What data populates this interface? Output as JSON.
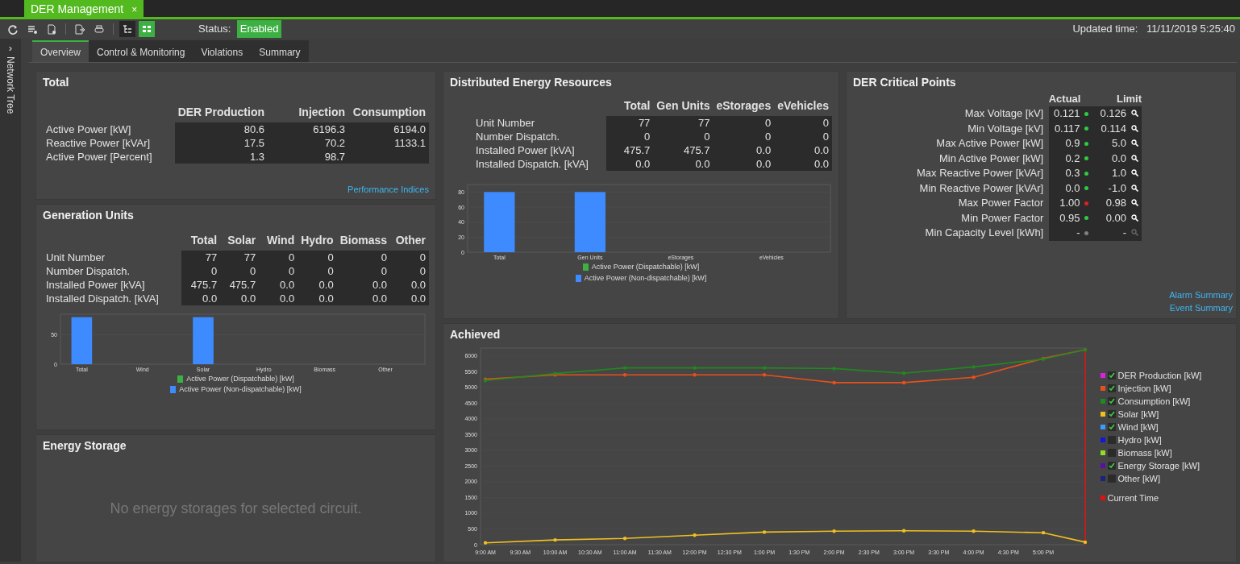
{
  "window": {
    "tab_title": "DER Management",
    "close": "×"
  },
  "toolbar": {
    "buttons": [
      {
        "kind": "refresh",
        "selected": false
      },
      {
        "kind": "list",
        "selected": false
      },
      {
        "kind": "document",
        "selected": false
      },
      {
        "kind": "export",
        "selected": false
      },
      {
        "kind": "print",
        "selected": false
      },
      {
        "kind": "tree",
        "selected": false
      },
      {
        "kind": "grid",
        "selected": true
      }
    ],
    "status_label": "Status:",
    "status_value": "Enabled",
    "updated_label": "Updated time:",
    "updated_value": "11/11/2019 5:25:40"
  },
  "side_panel": {
    "toggle": "›",
    "label": "Network Tree"
  },
  "tabs": [
    {
      "label": "Overview",
      "selected": true
    },
    {
      "label": "Control & Monitoring",
      "selected": false
    },
    {
      "label": "Violations",
      "selected": false
    },
    {
      "label": "Summary",
      "selected": false
    }
  ],
  "total": {
    "title": "Total",
    "columns": [
      "DER Production",
      "Injection",
      "Consumption"
    ],
    "rows": [
      {
        "label": "Active Power [kW]",
        "values": [
          "80.6",
          "6196.3",
          "6194.0"
        ]
      },
      {
        "label": "Reactive Power [kVAr]",
        "values": [
          "17.5",
          "70.2",
          "1133.1"
        ]
      },
      {
        "label": "Active Power [Percent]",
        "values": [
          "1.3",
          "98.7"
        ]
      }
    ],
    "link": "Performance Indices"
  },
  "generation_units": {
    "title": "Generation Units",
    "columns": [
      "Total",
      "Solar",
      "Wind",
      "Hydro",
      "Biomass",
      "Other"
    ],
    "rows": [
      {
        "label": "Unit Number",
        "values": [
          "77",
          "77",
          "0",
          "0",
          "0",
          "0"
        ]
      },
      {
        "label": "Number Dispatch.",
        "values": [
          "0",
          "0",
          "0",
          "0",
          "0",
          "0"
        ]
      },
      {
        "label": "Installed Power [kVA]",
        "values": [
          "475.7",
          "475.7",
          "0.0",
          "0.0",
          "0.0",
          "0.0"
        ]
      },
      {
        "label": "Installed Dispatch. [kVA]",
        "values": [
          "0.0",
          "0.0",
          "0.0",
          "0.0",
          "0.0",
          "0.0"
        ]
      }
    ],
    "chart_data": {
      "type": "bar",
      "categories": [
        "Total",
        "Wind",
        "Solar",
        "Hydro",
        "Biomass",
        "Other"
      ],
      "ylim": [
        0,
        85
      ],
      "yticks": [
        0,
        50
      ],
      "stacked": true,
      "grid": true,
      "series": [
        {
          "name": "Active Power (Dispatchable) [kW]",
          "color": "#3cb043",
          "values": [
            0,
            0,
            0,
            0,
            0,
            0
          ]
        },
        {
          "name": "Active Power (Non-dispatchable) [kW]",
          "color": "#3d8bff",
          "values": [
            80,
            0,
            80,
            0,
            0,
            0
          ]
        }
      ]
    }
  },
  "energy_storage": {
    "title": "Energy Storage",
    "message": "No energy storages for selected circuit."
  },
  "distributed_energy_resources": {
    "title": "Distributed Energy Resources",
    "columns": [
      "Total",
      "Gen Units",
      "eStorages",
      "eVehicles"
    ],
    "rows": [
      {
        "label": "Unit Number",
        "values": [
          "77",
          "77",
          "0",
          "0"
        ]
      },
      {
        "label": "Number Dispatch.",
        "values": [
          "0",
          "0",
          "0",
          "0"
        ]
      },
      {
        "label": "Installed Power [kVA]",
        "values": [
          "475.7",
          "475.7",
          "0.0",
          "0.0"
        ]
      },
      {
        "label": "Installed Dispatch. [kVA]",
        "values": [
          "0.0",
          "0.0",
          "0.0",
          "0.0"
        ]
      }
    ],
    "chart_data": {
      "type": "bar",
      "categories": [
        "Total",
        "Gen Units",
        "eStorages",
        "eVehicles"
      ],
      "ylim": [
        0,
        90
      ],
      "yticks": [
        0,
        20,
        40,
        60,
        80
      ],
      "stacked": true,
      "grid": true,
      "series": [
        {
          "name": "Active Power (Dispatchable) [kW]",
          "color": "#3cb043",
          "values": [
            0,
            0,
            0,
            0
          ]
        },
        {
          "name": "Active Power (Non-dispatchable) [kW]",
          "color": "#3d8bff",
          "values": [
            80,
            80,
            0,
            0
          ]
        }
      ]
    }
  },
  "critical_points": {
    "title": "DER Critical Points",
    "columns": [
      "Actual",
      "Limit"
    ],
    "rows": [
      {
        "label": "Max Voltage [kV]",
        "actual": "0.121",
        "limit": "0.126",
        "color": "#2ecc40",
        "disabled": false
      },
      {
        "label": "Min Voltage [kV]",
        "actual": "0.117",
        "limit": "0.114",
        "color": "#2ecc40",
        "disabled": false
      },
      {
        "label": "Max Active Power [kW]",
        "actual": "0.9",
        "limit": "5.0",
        "color": "#2ecc40",
        "disabled": false
      },
      {
        "label": "Min Active Power [kW]",
        "actual": "0.2",
        "limit": "0.0",
        "color": "#2ecc40",
        "disabled": false
      },
      {
        "label": "Max Reactive Power [kVAr]",
        "actual": "0.3",
        "limit": "1.0",
        "color": "#2ecc40",
        "disabled": false
      },
      {
        "label": "Min Reactive Power [kVAr]",
        "actual": "0.0",
        "limit": "-1.0",
        "color": "#2ecc40",
        "disabled": false
      },
      {
        "label": "Max Power Factor",
        "actual": "1.00",
        "limit": "0.98",
        "color": "#e02020",
        "disabled": false
      },
      {
        "label": "Min Power Factor",
        "actual": "0.95",
        "limit": "0.00",
        "color": "#2ecc40",
        "disabled": false
      },
      {
        "label": "Min Capacity Level [kWh]",
        "actual": "-",
        "limit": "-",
        "color": "#808080",
        "disabled": true
      }
    ],
    "links": [
      "Alarm Summary",
      "Event Summary"
    ]
  },
  "achieved": {
    "title": "Achieved",
    "chart_data": {
      "type": "line",
      "grid": true,
      "x": [
        9,
        10,
        11,
        12,
        13,
        14,
        15,
        16,
        17,
        17.6
      ],
      "xlim": [
        8.93,
        17.6
      ],
      "ylim": [
        0,
        6250
      ],
      "yticks": [
        0,
        500,
        1000,
        1500,
        2000,
        2500,
        3000,
        3500,
        4000,
        4500,
        5000,
        5500,
        6000
      ],
      "xticks": [
        {
          "value": 9,
          "label": "9:00 AM"
        },
        {
          "value": 9.5,
          "label": "9:30 AM"
        },
        {
          "value": 10,
          "label": "10:00 AM"
        },
        {
          "value": 10.5,
          "label": "10:30 AM"
        },
        {
          "value": 11,
          "label": "11:00 AM"
        },
        {
          "value": 11.5,
          "label": "11:30 AM"
        },
        {
          "value": 12,
          "label": "12:00 PM"
        },
        {
          "value": 12.5,
          "label": "12:30 PM"
        },
        {
          "value": 13,
          "label": "1:00 PM"
        },
        {
          "value": 13.5,
          "label": "1:30 PM"
        },
        {
          "value": 14,
          "label": "2:00 PM"
        },
        {
          "value": 14.5,
          "label": "2:30 PM"
        },
        {
          "value": 15,
          "label": "3:00 PM"
        },
        {
          "value": 15.5,
          "label": "3:30 PM"
        },
        {
          "value": 16,
          "label": "4:00 PM"
        },
        {
          "value": 16.5,
          "label": "4:30 PM"
        },
        {
          "value": 17,
          "label": "5:00 PM"
        }
      ],
      "series": [
        {
          "name": "Injection [kW]",
          "color": "#e8501a",
          "values": [
            5260,
            5400,
            5400,
            5400,
            5400,
            5150,
            5150,
            5320,
            5920,
            6200
          ]
        },
        {
          "name": "Consumption [kW]",
          "color": "#1f8a1f",
          "values": [
            5220,
            5440,
            5620,
            5620,
            5620,
            5600,
            5450,
            5650,
            5900,
            6200
          ]
        },
        {
          "name": "Solar [kW]",
          "color": "#f0c020",
          "values": [
            60,
            150,
            200,
            300,
            400,
            430,
            440,
            430,
            380,
            80
          ]
        }
      ]
    },
    "legend": [
      {
        "kind": "series",
        "label": "DER Production [kW]",
        "color": "#e020e0",
        "checked": true
      },
      {
        "kind": "plotted",
        "checked": true
      },
      {
        "kind": "plotted",
        "checked": true
      },
      {
        "kind": "plotted",
        "checked": true
      },
      {
        "kind": "series",
        "label": "Wind [kW]",
        "color": "#3d9bff",
        "checked": true
      },
      {
        "kind": "series",
        "label": "Hydro [kW]",
        "color": "#1515e0",
        "checked": false
      },
      {
        "kind": "series",
        "label": "Biomass [kW]",
        "color": "#90e020",
        "checked": false
      },
      {
        "kind": "series",
        "label": "Energy Storage [kW]",
        "color": "#5a10a0",
        "checked": true
      },
      {
        "kind": "series",
        "label": "Other [kW]",
        "color": "#20207a",
        "checked": false
      },
      {
        "kind": "marker",
        "label": "Current Time",
        "color": "#e01010"
      }
    ]
  }
}
